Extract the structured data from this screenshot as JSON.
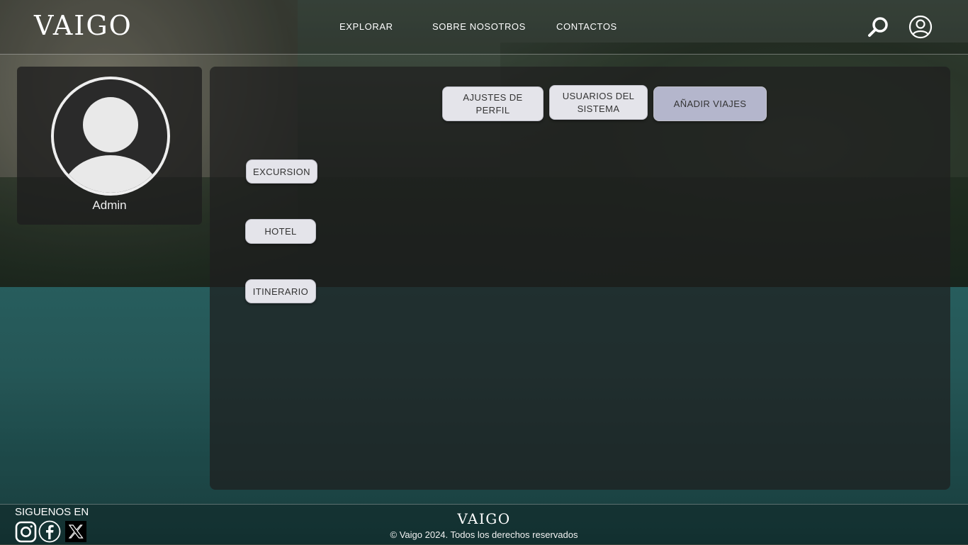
{
  "brand": {
    "logo": "VAIGO"
  },
  "nav": {
    "items": [
      {
        "label": "EXPLORAR"
      },
      {
        "label": "SOBRE NOSOTROS"
      },
      {
        "label": "CONTACTOS"
      }
    ],
    "search_icon": "search-icon",
    "user_icon": "user-circle-icon"
  },
  "profile": {
    "name": "Admin",
    "avatar_icon": "default-avatar-icon"
  },
  "tabs": [
    {
      "label": "AJUSTES DE PERFIL",
      "active": false
    },
    {
      "label": "USUARIOS DEL SISTEMA",
      "active": false
    },
    {
      "label": "AÑADIR VIAJES",
      "active": true
    }
  ],
  "side_buttons": [
    {
      "label": "EXCURSION"
    },
    {
      "label": "HOTEL"
    },
    {
      "label": "ITINERARIO"
    }
  ],
  "footer": {
    "follow_label": "SIGUENOS EN",
    "social": [
      "instagram-icon",
      "facebook-icon",
      "x-icon"
    ],
    "logo": "VAIGO",
    "copyright": "© Vaigo 2024. Todos los derechos reservados"
  },
  "colors": {
    "button_bg": "#e4e4ea",
    "button_active_bg": "#b4b6cc",
    "panel_bg": "rgba(30,30,30,0.72)"
  }
}
